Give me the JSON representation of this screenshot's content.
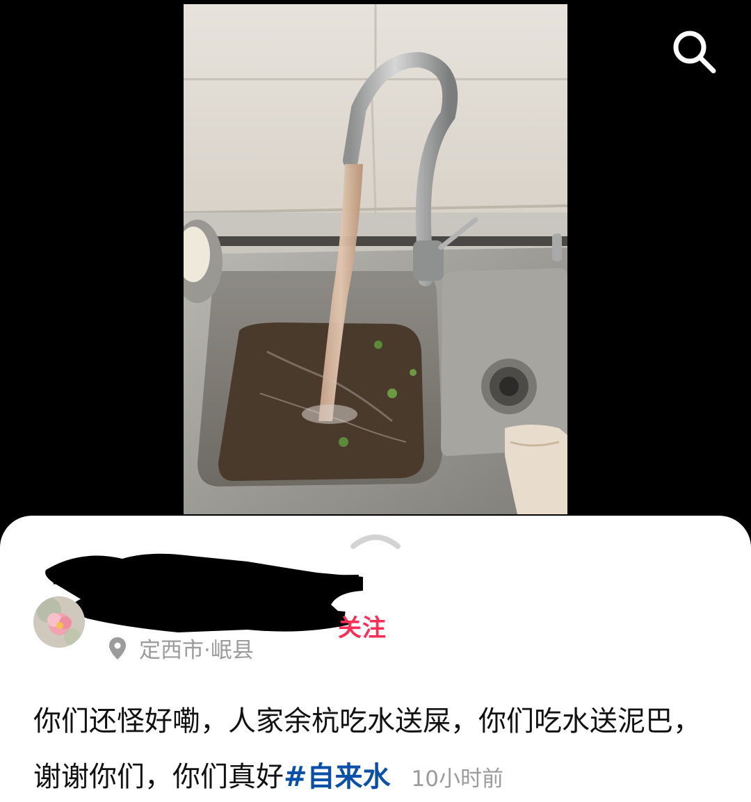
{
  "icons": {
    "search": "search-icon",
    "collapse": "chevron-up-icon",
    "location": "location-pin-icon"
  },
  "colors": {
    "follow": "#ff2d55",
    "hashtag": "#0a4fa8",
    "meta": "#9b9b9b"
  },
  "post": {
    "follow_label": "关注",
    "location": "定西市·岷县",
    "text": "你们还怪好嘞，人家余杭吃水送屎，你们吃水送泥巴，谢谢你们，你们真好",
    "hashtag": "#自来水",
    "time": "10小时前"
  }
}
